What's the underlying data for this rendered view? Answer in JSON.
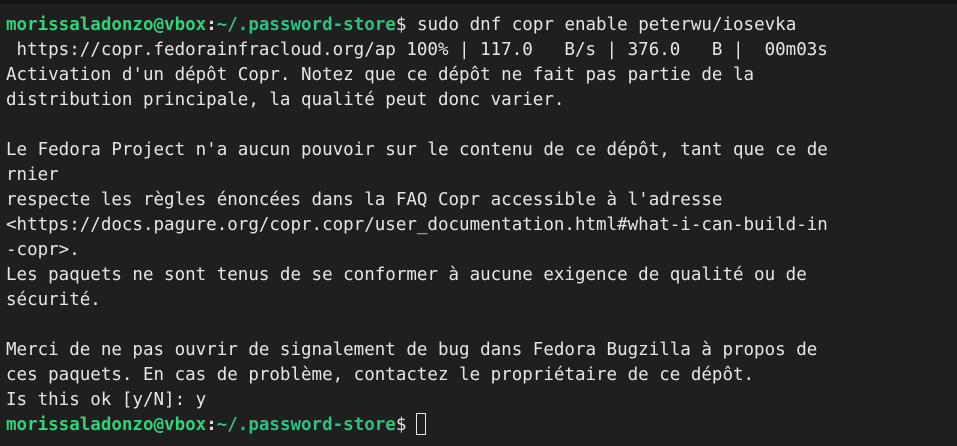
{
  "prompt": {
    "user_host": "morissaladonzo@vbox",
    "colon": ":",
    "path": "~/.password-store",
    "dollar": "$"
  },
  "command": " sudo dnf copr enable peterwu/iosevka",
  "output_lines": [
    " https://copr.fedorainfracloud.org/ap 100% | 117.0   B/s | 376.0   B |  00m03s",
    "Activation d'un dépôt Copr. Notez que ce dépôt ne fait pas partie de la",
    "distribution principale, la qualité peut donc varier.",
    "",
    "Le Fedora Project n'a aucun pouvoir sur le contenu de ce dépôt, tant que ce de",
    "rnier",
    "respecte les règles énoncées dans la FAQ Copr accessible à l'adresse",
    "<https://docs.pagure.org/copr.copr/user_documentation.html#what-i-can-build-in",
    "-copr>.",
    "Les paquets ne sont tenus de se conformer à aucune exigence de qualité ou de",
    "sécurité.",
    "",
    "Merci de ne pas ouvrir de signalement de bug dans Fedora Bugzilla à propos de",
    "ces paquets. En cas de problème, contactez le propriétaire de ce dépôt.",
    "Is this ok [y/N]: y"
  ]
}
